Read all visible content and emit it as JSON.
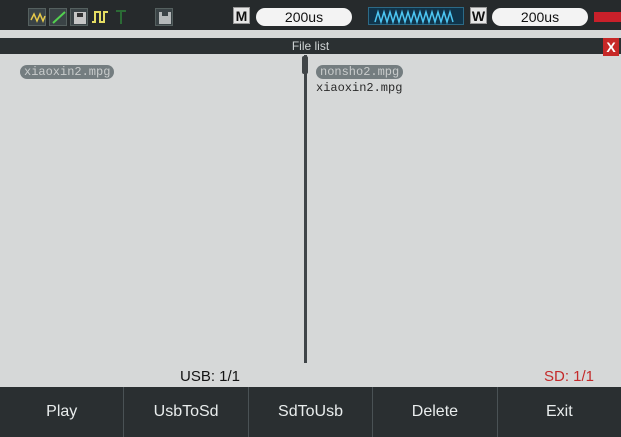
{
  "toolbar": {
    "icons": [
      "waveform-icon",
      "ramp-icon",
      "disk-icon",
      "pulse-icon",
      "trigger-icon",
      "save-icon"
    ],
    "mode_badge": "M",
    "timebase": "200us",
    "window_badge": "W",
    "window_timebase": "200us"
  },
  "dialog": {
    "title": "File  list",
    "close": "X"
  },
  "usb_files": [
    {
      "name": "xiaoxin2.mpg",
      "selected": true
    }
  ],
  "sd_files": [
    {
      "name": "nonsho2.mpg",
      "selected": true
    },
    {
      "name": "xiaoxin2.mpg",
      "selected": false
    }
  ],
  "status": {
    "usb": "USB: 1/1",
    "sd": "SD: 1/1"
  },
  "softkeys": [
    "Play",
    "UsbToSd",
    "SdToUsb",
    "Delete",
    "Exit"
  ],
  "colors": {
    "sd_status": "#c42a2a",
    "close_bg": "#c62827"
  }
}
